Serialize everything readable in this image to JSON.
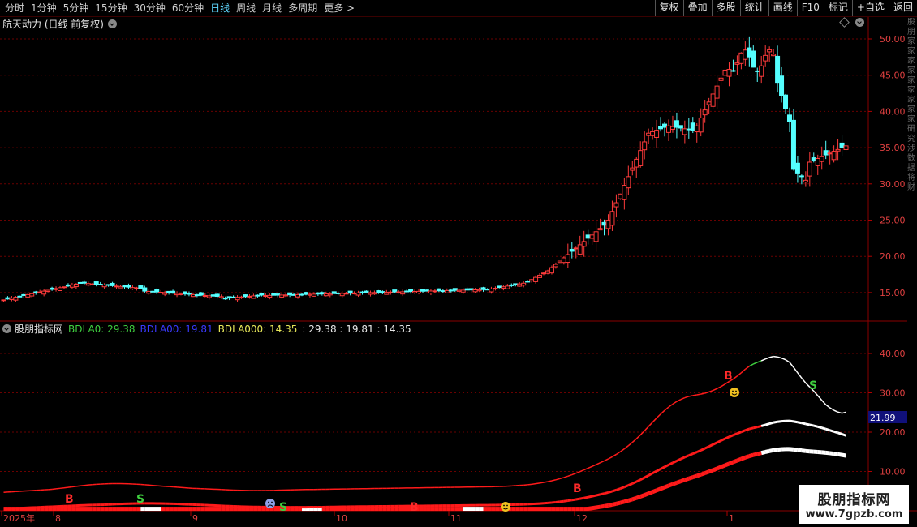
{
  "toolbar": {
    "periods": [
      "分时",
      "1分钟",
      "5分钟",
      "15分钟",
      "30分钟",
      "60分钟",
      "日线",
      "周线",
      "月线",
      "多周期",
      "更多 >"
    ],
    "active_period": "日线",
    "right_buttons": [
      "复权",
      "叠加",
      "多股",
      "统计",
      "画线",
      "F10",
      "标记",
      "+自选",
      "返回"
    ]
  },
  "stock_title": "航天动力 (日线 前复权)",
  "indicator": {
    "name": "股朋指标网",
    "l1": "BDLA0: 29.38",
    "l2": "BDLA00: 19.81",
    "l3": "BDLA000: 14.35",
    "tail": ": 29.38 : 19.81 : 14.35",
    "colors": {
      "l1": "#3fcf3f",
      "l2": "#2a2aff",
      "l3": "#e8e85a"
    }
  },
  "price_axis": [
    "50.00",
    "45.00",
    "40.00",
    "35.00",
    "30.00",
    "25.00",
    "20.00",
    "15.00"
  ],
  "ind_axis": [
    "40.00",
    "30.00",
    "20.00",
    "10.00"
  ],
  "ind_highlight": "21.99",
  "dates": [
    "2025年",
    "8",
    "9",
    "10",
    "11",
    "12",
    "1"
  ],
  "markers": {
    "b": "B",
    "s": "S"
  },
  "watermark": {
    "line1": "股朋指标网",
    "line2": "www.7gpzb.com"
  },
  "icons": [
    "chevron-down-icon",
    "diamond-icon",
    "smiley-icon",
    "sad-face-icon"
  ],
  "side_chars": "股朋家家家家家家家家家研究涉数据将财"
}
